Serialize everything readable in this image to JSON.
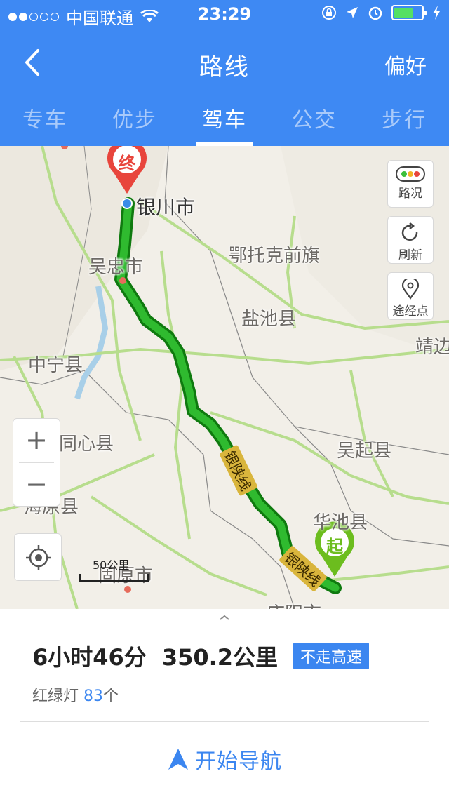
{
  "status_bar": {
    "carrier": "中国联通",
    "time": "23:29"
  },
  "header": {
    "title": "路线",
    "right_action": "偏好",
    "back_icon": "chevron-left-icon"
  },
  "tabs": [
    {
      "label": "专车",
      "active": false
    },
    {
      "label": "优步",
      "active": false
    },
    {
      "label": "驾车",
      "active": true
    },
    {
      "label": "公交",
      "active": false
    },
    {
      "label": "步行",
      "active": false
    }
  ],
  "map": {
    "end_marker": "终",
    "start_marker": "起",
    "labels": {
      "yinchuan": "银川市",
      "etuoke": "鄂托克前旗",
      "wuzhong": "吴忠市",
      "yanchi": "盐池县",
      "jingbian": "靖边",
      "zhongning": "中宁县",
      "tongxin": "同心县",
      "wuqi": "吴起县",
      "haiyuan": "海原县",
      "huachi": "华池县",
      "guyuan": "固原市",
      "qingyang": "庆阳市"
    },
    "route_labels": [
      "银陕线",
      "银陕线"
    ],
    "buttons": {
      "traffic": "路况",
      "refresh": "刷新",
      "waypoint": "途经点"
    },
    "zoom_in": "+",
    "zoom_out": "−",
    "scale": "50公里",
    "colors": {
      "route": "#1fa31f",
      "route_border": "#0f7a0f",
      "end_marker": "#e8453c",
      "start_marker": "#6cbd1e",
      "accent": "#3e89f3"
    }
  },
  "panel": {
    "duration": "6小时46分",
    "distance": "350.2公里",
    "badge": "不走高速",
    "lights_label": "红绿灯",
    "lights_count": "83",
    "lights_unit": "个",
    "start_nav": "开始导航"
  }
}
